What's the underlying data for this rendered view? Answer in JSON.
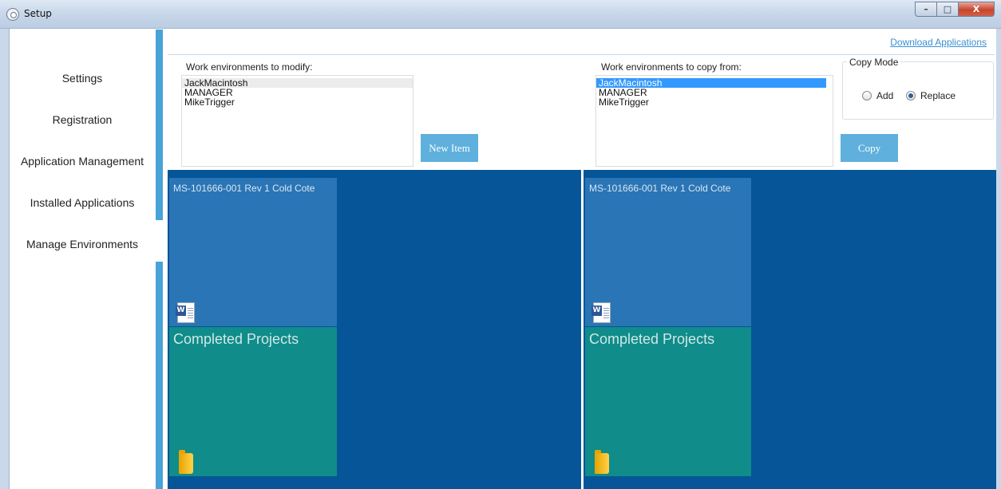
{
  "window": {
    "title": "Setup",
    "controls": {
      "minimize": "–",
      "maximize": "□",
      "close": "X"
    },
    "icon": "gear-icon"
  },
  "sidebar": {
    "items": [
      {
        "label": "Settings"
      },
      {
        "label": "Registration"
      },
      {
        "label": "Application Management"
      },
      {
        "label": "Installed Applications"
      },
      {
        "label": "Manage Environments"
      }
    ]
  },
  "header": {
    "download_link": "Download Applications"
  },
  "modify": {
    "label": "Work environments to modify:",
    "items": [
      "JackMacintosh",
      "MANAGER",
      "MikeTrigger"
    ],
    "new_item_button": "New Item"
  },
  "copy_from": {
    "label": "Work environments to copy from:",
    "items": [
      "JackMacintosh",
      "MANAGER",
      "MikeTrigger"
    ],
    "selected": "JackMacintosh",
    "copy_button": "Copy"
  },
  "copy_mode": {
    "title": "Copy Mode",
    "options": [
      "Add",
      "Replace"
    ],
    "selected": "Replace"
  },
  "left_panel": {
    "doc_tile": {
      "title": "MS-101666-001 Rev 1 Cold Cote",
      "icon": "word-document-icon"
    },
    "folder_tile": {
      "title": "Completed Projects",
      "icon": "folder-icon"
    }
  },
  "right_panel": {
    "doc_tile": {
      "title": "MS-101666-001 Rev 1 Cold Cote",
      "icon": "word-document-icon"
    },
    "folder_tile": {
      "title": "Completed Projects",
      "icon": "folder-icon"
    }
  },
  "colors": {
    "panel_background": "#055598",
    "doc_tile": "#2a75b6",
    "folder_tile": "#108c8a",
    "accent": "#5fb0dc",
    "selection": "#3399ff"
  }
}
